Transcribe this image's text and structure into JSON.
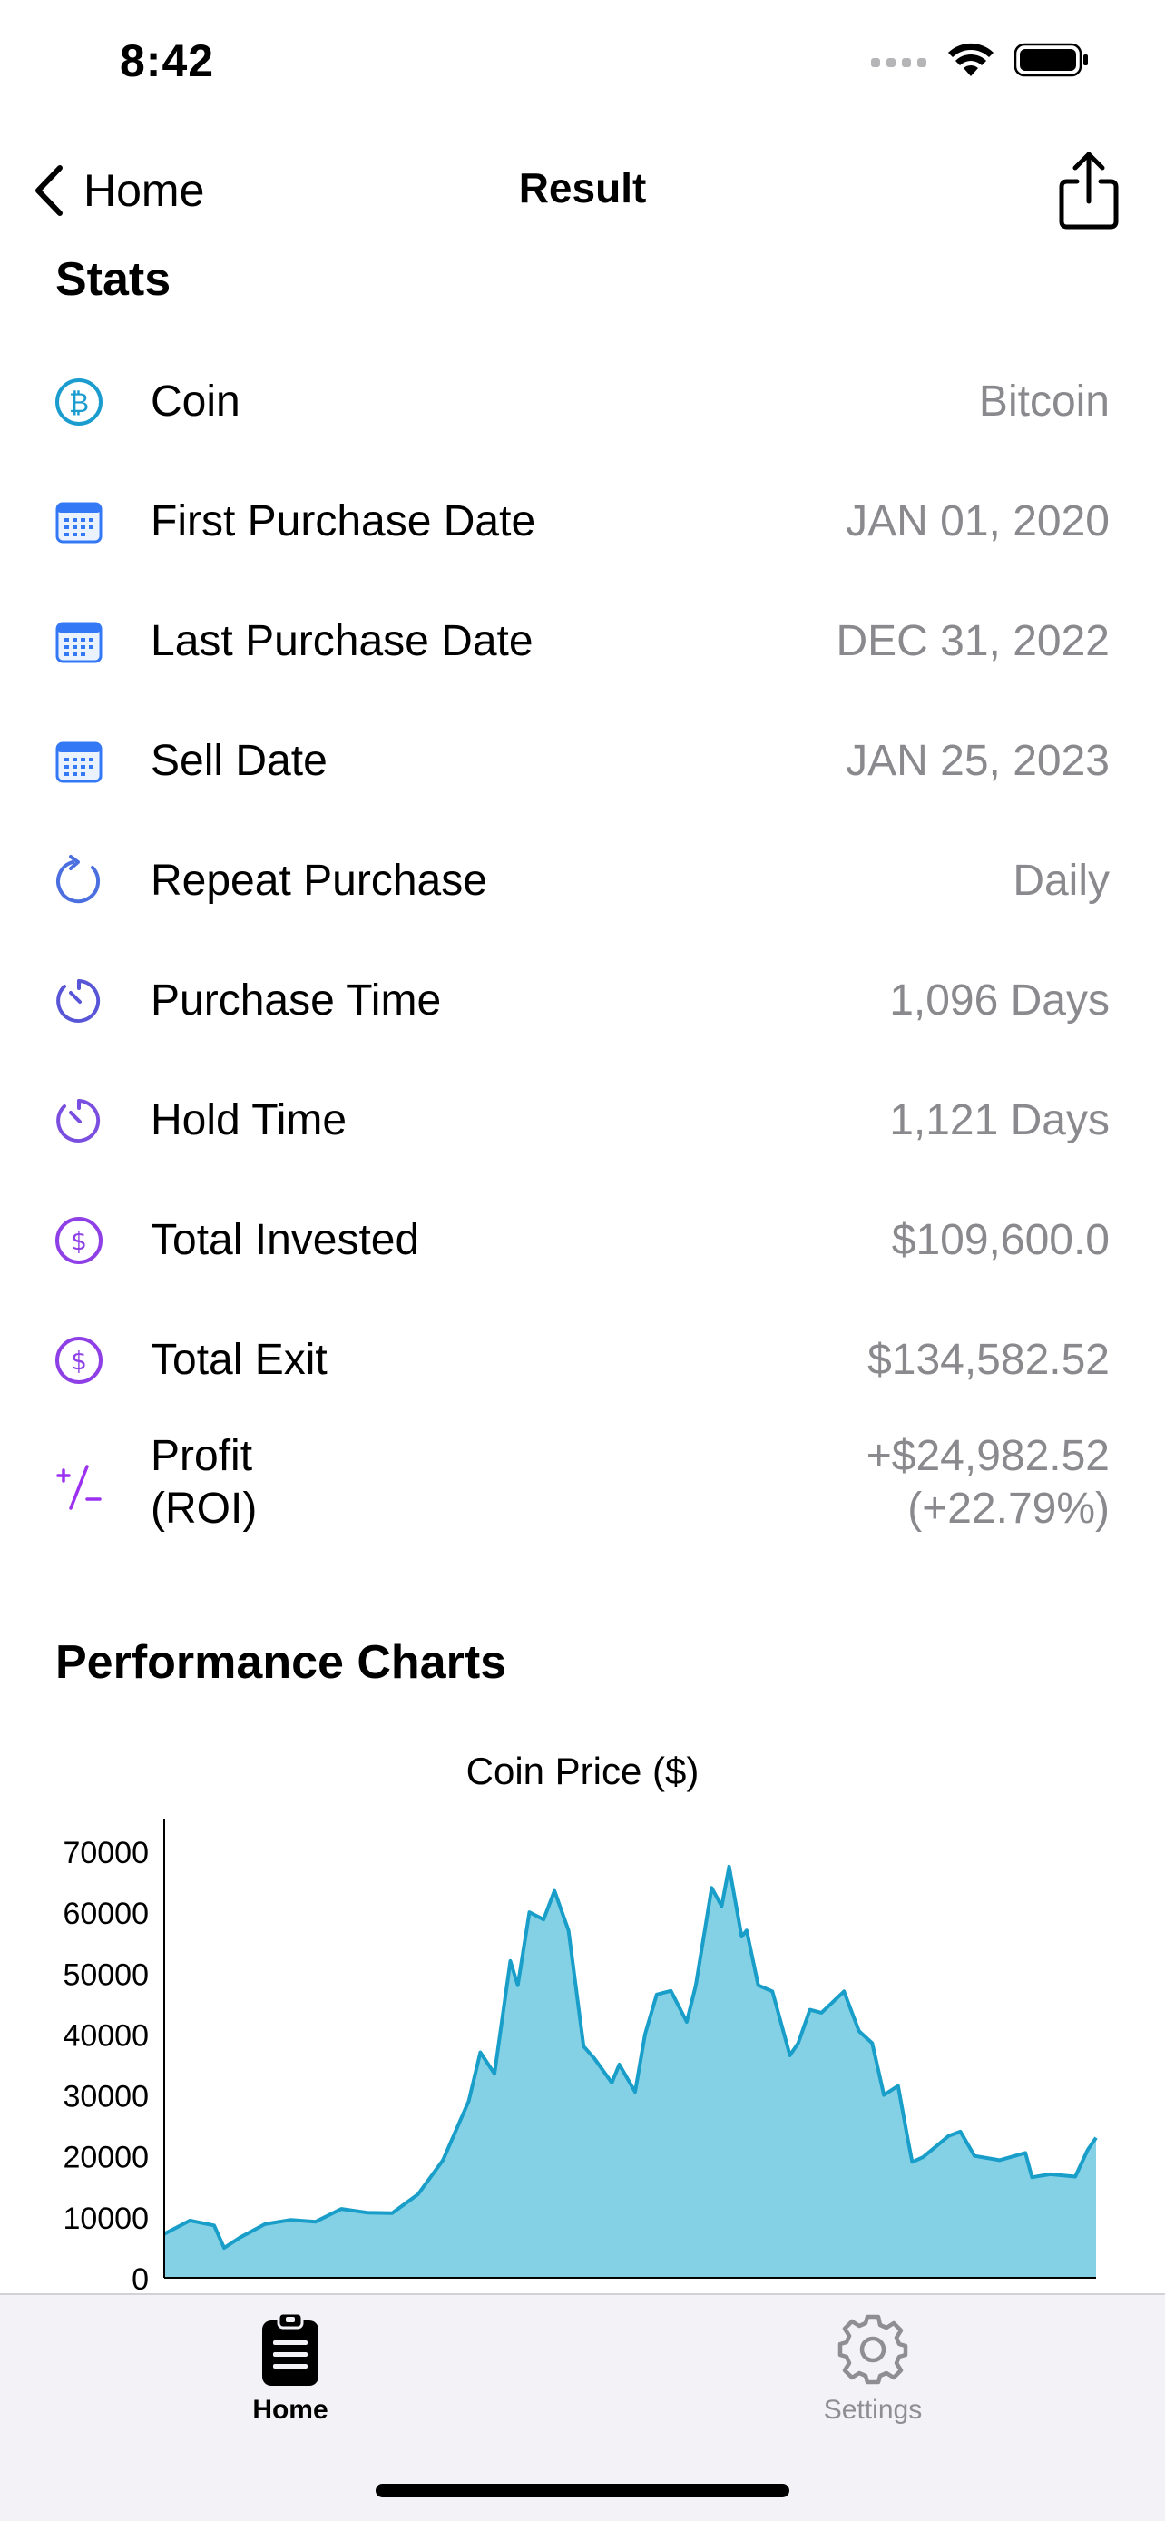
{
  "status": {
    "time": "8:42"
  },
  "nav": {
    "back_label": "Home",
    "title": "Result"
  },
  "sections": {
    "stats_title": "Stats",
    "charts_title": "Performance Charts"
  },
  "stats": [
    {
      "icon": "bitcoin-circle-icon",
      "label": "Coin",
      "value": "Bitcoin"
    },
    {
      "icon": "calendar-icon",
      "label": "First Purchase Date",
      "value": "JAN 01, 2020"
    },
    {
      "icon": "calendar-icon",
      "label": "Last Purchase Date",
      "value": "DEC 31, 2022"
    },
    {
      "icon": "calendar-icon",
      "label": "Sell Date",
      "value": "JAN 25, 2023"
    },
    {
      "icon": "repeat-arrow-icon",
      "label": "Repeat Purchase",
      "value": "Daily"
    },
    {
      "icon": "timer-icon",
      "label": "Purchase Time",
      "value": "1,096 Days"
    },
    {
      "icon": "timer-icon",
      "label": "Hold Time",
      "value": "1,121 Days"
    },
    {
      "icon": "dollar-circle-icon",
      "label": "Total Invested",
      "value": "$109,600.0"
    },
    {
      "icon": "dollar-circle-icon",
      "label": "Total Exit",
      "value": "$134,582.52"
    },
    {
      "icon": "plus-minus-icon",
      "label_line1": "Profit",
      "label_line2": "(ROI)",
      "value_line1": "+$24,982.52",
      "value_line2": "(+22.79%)"
    }
  ],
  "colors": {
    "coin_icon": "#1a9ccf",
    "calendar_icon": "#3478f6",
    "repeat_icon": "#4c6fe0",
    "timer_icon_a": "#5856d6",
    "timer_icon_b": "#7a4fe0",
    "dollar_icon": "#8e3fe6",
    "profit_icon": "#9b30f0",
    "chart_fill": "#84d1e6",
    "chart_line": "#189ec9",
    "tab_active": "#000000",
    "tab_inactive": "#8e8e93"
  },
  "chart_data": {
    "type": "area",
    "title": "Coin Price ($)",
    "ylim": [
      0,
      70000
    ],
    "yticks": [
      "70000",
      "60000",
      "50000",
      "40000",
      "30000",
      "20000",
      "10000",
      "0"
    ],
    "ytick_values": [
      70000,
      60000,
      50000,
      40000,
      30000,
      20000,
      10000,
      0
    ],
    "x": [
      "2020-01-01",
      "2020-02-01",
      "2020-03-01",
      "2020-03-13",
      "2020-04-01",
      "2020-05-01",
      "2020-06-01",
      "2020-07-01",
      "2020-08-01",
      "2020-09-01",
      "2020-10-01",
      "2020-11-01",
      "2020-12-01",
      "2021-01-01",
      "2021-01-15",
      "2021-02-01",
      "2021-02-20",
      "2021-03-01",
      "2021-03-15",
      "2021-04-01",
      "2021-04-14",
      "2021-05-01",
      "2021-05-19",
      "2021-06-01",
      "2021-06-22",
      "2021-07-01",
      "2021-07-20",
      "2021-08-01",
      "2021-08-15",
      "2021-09-01",
      "2021-09-20",
      "2021-10-01",
      "2021-10-20",
      "2021-11-01",
      "2021-11-10",
      "2021-11-25",
      "2021-12-01",
      "2021-12-15",
      "2022-01-01",
      "2022-01-22",
      "2022-02-01",
      "2022-02-15",
      "2022-03-01",
      "2022-03-28",
      "2022-04-15",
      "2022-05-01",
      "2022-05-15",
      "2022-06-01",
      "2022-06-13",
      "2022-06-18",
      "2022-07-01",
      "2022-08-01",
      "2022-08-15",
      "2022-09-01",
      "2022-10-01",
      "2022-11-01",
      "2022-11-09",
      "2022-12-01",
      "2022-12-31",
      "2023-01-15",
      "2023-01-25"
    ],
    "series": [
      {
        "values": [
          7200,
          9400,
          8600,
          4900,
          6600,
          8800,
          9500,
          9200,
          11300,
          10700,
          10600,
          13700,
          19300,
          29000,
          37000,
          33500,
          52000,
          48000,
          60000,
          58800,
          63500,
          57000,
          38000,
          36000,
          32000,
          35000,
          30500,
          40000,
          46500,
          47100,
          42000,
          48000,
          64000,
          61000,
          67500,
          56000,
          57000,
          48000,
          47000,
          36500,
          38500,
          44000,
          43500,
          47000,
          40500,
          38500,
          30000,
          31500,
          22500,
          19000,
          19800,
          23300,
          24000,
          20000,
          19300,
          20500,
          16500,
          17000,
          16600,
          21000,
          23000
        ]
      }
    ]
  },
  "tabs": [
    {
      "label": "Home",
      "icon": "clipboard-icon",
      "active": true
    },
    {
      "label": "Settings",
      "icon": "gear-icon",
      "active": false
    }
  ]
}
